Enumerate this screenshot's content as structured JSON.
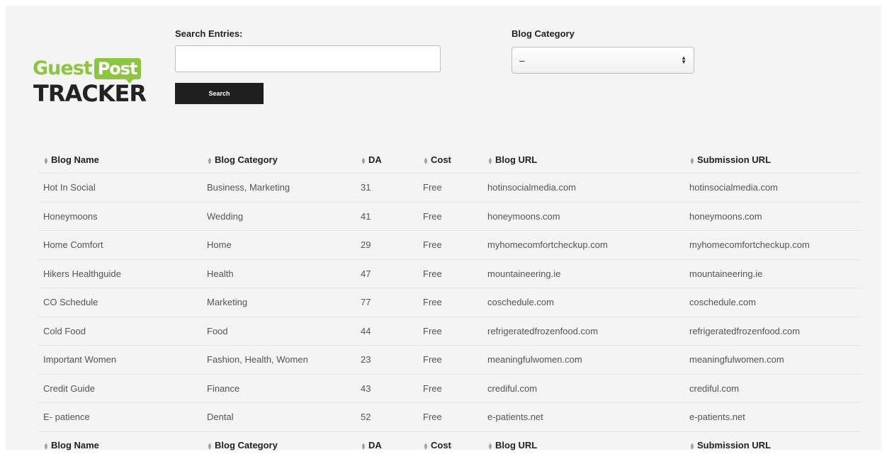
{
  "logo": {
    "guest": "Guest",
    "post": "Post",
    "tracker": "TRACKER"
  },
  "search": {
    "label": "Search Entries:",
    "value": "",
    "placeholder": "",
    "button_label": "Search"
  },
  "category_filter": {
    "label": "Blog Category",
    "selected": "–"
  },
  "table": {
    "columns": [
      "Blog Name",
      "Blog Category",
      "DA",
      "Cost",
      "Blog URL",
      "Submission URL"
    ],
    "rows": [
      [
        "Hot In Social",
        "Business, Marketing",
        "31",
        "Free",
        "hotinsocialmedia.com",
        "hotinsocialmedia.com"
      ],
      [
        "Honeymoons",
        "Wedding",
        "41",
        "Free",
        "honeymoons.com",
        "honeymoons.com"
      ],
      [
        "Home Comfort",
        "Home",
        "29",
        "Free",
        "myhomecomfortcheckup.com",
        "myhomecomfortcheckup.com"
      ],
      [
        "Hikers Healthguide",
        "Health",
        "47",
        "Free",
        "mountaineering.ie",
        "mountaineering.ie"
      ],
      [
        "CO Schedule",
        "Marketing",
        "77",
        "Free",
        "coschedule.com",
        "coschedule.com"
      ],
      [
        "Cold Food",
        "Food",
        "44",
        "Free",
        "refrigeratedfrozenfood.com",
        "refrigeratedfrozenfood.com"
      ],
      [
        "Important Women",
        "Fashion, Health, Women",
        "23",
        "Free",
        "meaningfulwomen.com",
        "meaningfulwomen.com"
      ],
      [
        "Credit Guide",
        "Finance",
        "43",
        "Free",
        "crediful.com",
        "crediful.com"
      ],
      [
        "E- patience",
        "Dental",
        "52",
        "Free",
        "e-patients.net",
        "e-patients.net"
      ]
    ]
  },
  "icons": {
    "sort": "sort-icon",
    "select_arrows": "select-arrows-icon"
  },
  "colors": {
    "brand_green": "#8cc63f",
    "button_dark": "#1f1f1f",
    "page_bg": "#f4f4f4"
  }
}
